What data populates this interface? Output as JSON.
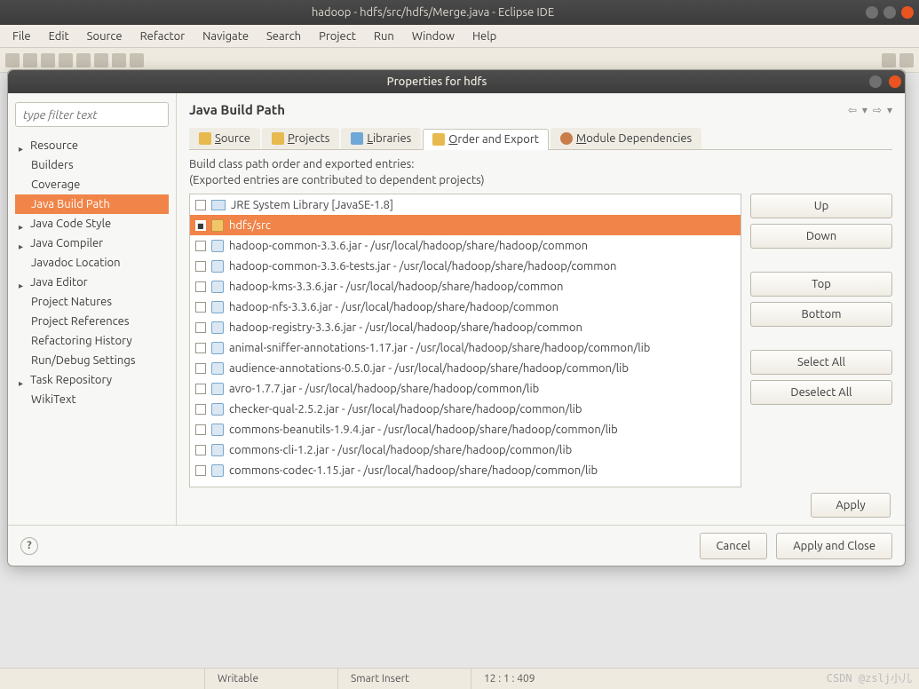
{
  "window": {
    "title": "hadoop - hdfs/src/hdfs/Merge.java - Eclipse IDE"
  },
  "menubar": [
    "File",
    "Edit",
    "Source",
    "Refactor",
    "Navigate",
    "Search",
    "Project",
    "Run",
    "Window",
    "Help"
  ],
  "dialog": {
    "title": "Properties for hdfs",
    "filter_placeholder": "type filter text",
    "page_title": "Java Build Path",
    "tree": [
      {
        "label": "Resource",
        "arrow": true,
        "indent": false,
        "selected": false
      },
      {
        "label": "Builders",
        "arrow": false,
        "indent": true,
        "selected": false
      },
      {
        "label": "Coverage",
        "arrow": false,
        "indent": true,
        "selected": false
      },
      {
        "label": "Java Build Path",
        "arrow": false,
        "indent": true,
        "selected": true
      },
      {
        "label": "Java Code Style",
        "arrow": true,
        "indent": false,
        "selected": false
      },
      {
        "label": "Java Compiler",
        "arrow": true,
        "indent": false,
        "selected": false
      },
      {
        "label": "Javadoc Location",
        "arrow": false,
        "indent": true,
        "selected": false
      },
      {
        "label": "Java Editor",
        "arrow": true,
        "indent": false,
        "selected": false
      },
      {
        "label": "Project Natures",
        "arrow": false,
        "indent": true,
        "selected": false
      },
      {
        "label": "Project References",
        "arrow": false,
        "indent": true,
        "selected": false
      },
      {
        "label": "Refactoring History",
        "arrow": false,
        "indent": true,
        "selected": false
      },
      {
        "label": "Run/Debug Settings",
        "arrow": false,
        "indent": true,
        "selected": false
      },
      {
        "label": "Task Repository",
        "arrow": true,
        "indent": false,
        "selected": false
      },
      {
        "label": "WikiText",
        "arrow": false,
        "indent": true,
        "selected": false
      }
    ],
    "tabs": [
      {
        "label": "Source",
        "u": "S",
        "icon": "ic-src"
      },
      {
        "label": "Projects",
        "u": "P",
        "icon": "ic-prj"
      },
      {
        "label": "Libraries",
        "u": "L",
        "icon": "ic-lib"
      },
      {
        "label": "Order and Export",
        "u": "O",
        "icon": "ic-ord",
        "active": true
      },
      {
        "label": "Module Dependencies",
        "u": "M",
        "icon": "ic-mod"
      }
    ],
    "desc_line1": "Build class path order and exported entries:",
    "desc_line2": "(Exported entries are contributed to dependent projects)",
    "entries": [
      {
        "label": "JRE System Library [JavaSE-1.8]",
        "checked": false,
        "icon": "syslib",
        "selected": false
      },
      {
        "label": "hdfs/src",
        "checked": true,
        "icon": "srcfold",
        "selected": true
      },
      {
        "label": "hadoop-common-3.3.6.jar - /usr/local/hadoop/share/hadoop/common",
        "checked": false,
        "icon": "jar",
        "selected": false
      },
      {
        "label": "hadoop-common-3.3.6-tests.jar - /usr/local/hadoop/share/hadoop/common",
        "checked": false,
        "icon": "jar",
        "selected": false
      },
      {
        "label": "hadoop-kms-3.3.6.jar - /usr/local/hadoop/share/hadoop/common",
        "checked": false,
        "icon": "jar",
        "selected": false
      },
      {
        "label": "hadoop-nfs-3.3.6.jar - /usr/local/hadoop/share/hadoop/common",
        "checked": false,
        "icon": "jar",
        "selected": false
      },
      {
        "label": "hadoop-registry-3.3.6.jar - /usr/local/hadoop/share/hadoop/common",
        "checked": false,
        "icon": "jar",
        "selected": false
      },
      {
        "label": "animal-sniffer-annotations-1.17.jar - /usr/local/hadoop/share/hadoop/common/lib",
        "checked": false,
        "icon": "jar",
        "selected": false
      },
      {
        "label": "audience-annotations-0.5.0.jar - /usr/local/hadoop/share/hadoop/common/lib",
        "checked": false,
        "icon": "jar",
        "selected": false
      },
      {
        "label": "avro-1.7.7.jar - /usr/local/hadoop/share/hadoop/common/lib",
        "checked": false,
        "icon": "jar",
        "selected": false
      },
      {
        "label": "checker-qual-2.5.2.jar - /usr/local/hadoop/share/hadoop/common/lib",
        "checked": false,
        "icon": "jar",
        "selected": false
      },
      {
        "label": "commons-beanutils-1.9.4.jar - /usr/local/hadoop/share/hadoop/common/lib",
        "checked": false,
        "icon": "jar",
        "selected": false
      },
      {
        "label": "commons-cli-1.2.jar - /usr/local/hadoop/share/hadoop/common/lib",
        "checked": false,
        "icon": "jar",
        "selected": false
      },
      {
        "label": "commons-codec-1.15.jar - /usr/local/hadoop/share/hadoop/common/lib",
        "checked": false,
        "icon": "jar",
        "selected": false
      }
    ],
    "buttons": {
      "up": "Up",
      "down": "Down",
      "top": "Top",
      "bottom": "Bottom",
      "select_all": "Select All",
      "deselect_all": "Deselect All",
      "apply": "Apply"
    },
    "footer": {
      "cancel": "Cancel",
      "apply_close": "Apply and Close"
    }
  },
  "statusbar": {
    "c1": "",
    "c2": "Writable",
    "c3": "Smart Insert",
    "c4": "12 : 1 : 409"
  },
  "watermark": "CSDN @zslj小儿"
}
